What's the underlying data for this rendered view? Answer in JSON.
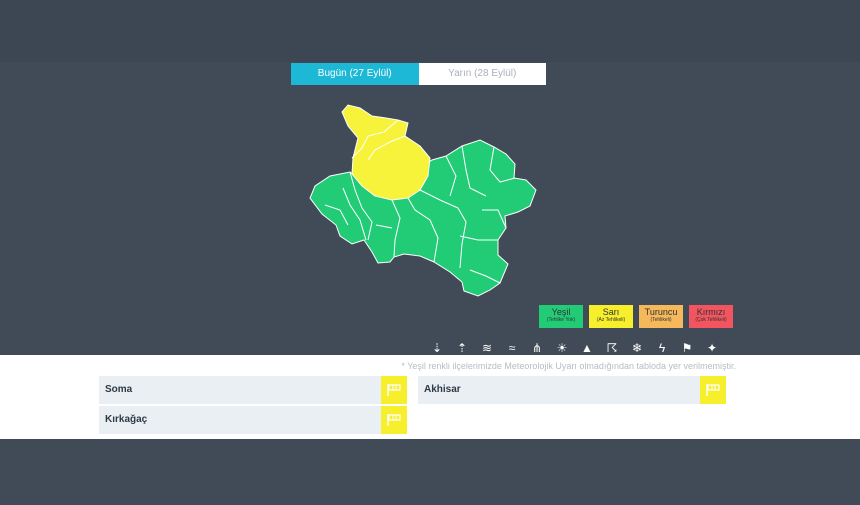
{
  "tabs": [
    {
      "label": "Bugün (27 Eylül)",
      "active": true
    },
    {
      "label": "Yarın (28 Eylül)",
      "active": false
    }
  ],
  "legend": [
    {
      "label": "Yeşil",
      "sub": "(Tehlike Yok)",
      "color": "#22cc77"
    },
    {
      "label": "Sarı",
      "sub": "(Az Tehlikeli)",
      "color": "#f7ee2c"
    },
    {
      "label": "Turuncu",
      "sub": "(Tehlikeli)",
      "color": "#f5b85a"
    },
    {
      "label": "Kırmızı",
      "sub": "(Çok Tehlikeli)",
      "color": "#f2555f"
    }
  ],
  "icons": [
    "thermometer-down-icon",
    "thermometer-up-icon",
    "fog-icon",
    "wind-icon",
    "rain-icon",
    "sun-heat-icon",
    "avalanche-icon",
    "storm-icon",
    "snow-icon",
    "lightning-icon",
    "wind-flag-icon",
    "dust-icon"
  ],
  "note": "* Yeşil renkli ilçelerimizde Meteorolojik Uyarı olmadığından tabloda yer verilmemiştir.",
  "districts": [
    {
      "name": "Soma",
      "level_color": "#f7ee2c"
    },
    {
      "name": "Akhisar",
      "level_color": "#f7ee2c"
    },
    {
      "name": "Kırkağaç",
      "level_color": "#f7ee2c"
    }
  ],
  "map_colors": {
    "green": "#22cc77",
    "yellow": "#f7f23a"
  }
}
